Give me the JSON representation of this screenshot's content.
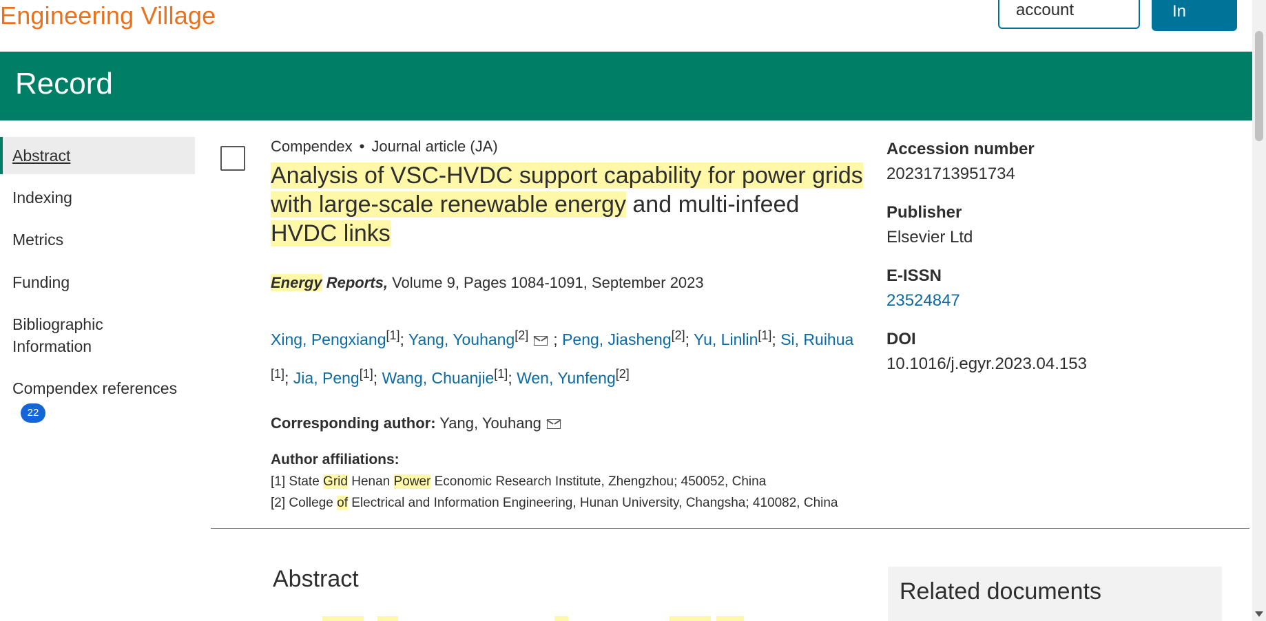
{
  "header": {
    "logo": "Engineering Village",
    "account_btn": "account",
    "signin_btn": "In"
  },
  "banner": {
    "title": "Record"
  },
  "sidebar": {
    "items": [
      {
        "label": "Abstract"
      },
      {
        "label": "Indexing"
      },
      {
        "label": "Metrics"
      },
      {
        "label": "Funding"
      },
      {
        "label": "Bibliographic"
      },
      {
        "label": "Information"
      },
      {
        "label": "Compendex references"
      }
    ],
    "badge": "22"
  },
  "record": {
    "database": "Compendex",
    "doc_type": "Journal article (JA)",
    "title_parts": [
      "Analysis of VSC-HVDC support capability for power grids with large-scale renewable energy",
      " and multi-infeed ",
      "HVDC links"
    ],
    "source_bold_1": "Energy",
    "source_bold_2": "Reports,",
    "source_rest": "Volume 9, Pages 1084-1091, September 2023",
    "authors": [
      {
        "name": "Xing, Pengxiang",
        "aff": "[1]"
      },
      {
        "name": "Yang, Youhang",
        "aff": "[2]"
      },
      {
        "name": "Peng, Jiasheng",
        "aff": "[2]"
      },
      {
        "name": "Yu, Linlin",
        "aff": "[1]"
      },
      {
        "name": "Si, Ruihua",
        "aff": "[1]"
      },
      {
        "name": "Jia, Peng",
        "aff": "[1]"
      },
      {
        "name": "Wang, Chuanjie",
        "aff": "[1]"
      },
      {
        "name": "Wen, Yunfeng",
        "aff": "[2]"
      }
    ],
    "sep": ";",
    "corr_label": "Corresponding author:",
    "corr_name": "Yang, Youhang",
    "aff_heading": "Author affiliations:",
    "affiliations": {
      "a1_prefix": "[1] State ",
      "a1_hl1": "Grid",
      "a1_mid": " Henan ",
      "a1_hl2": "Power",
      "a1_rest": " Economic Research Institute, Zhengzhou; 450052, China",
      "a2_prefix": "[2] College ",
      "a2_hl": "of",
      "a2_rest": " Electrical and Information Engineering, Hunan University, Changsha; 410082, China"
    }
  },
  "details": {
    "accession_label": "Accession number",
    "accession_value": "20231713951734",
    "publisher_label": "Publisher",
    "publisher_value": "Elsevier Ltd",
    "eissn_label": "E-ISSN",
    "eissn_value": "23524847",
    "doi_label": "DOI",
    "doi_value": "10.1016/j.egyr.2023.04.153"
  },
  "sections": {
    "abstract_heading": "Abstract",
    "related_heading": "Related documents"
  },
  "colors": {
    "banner": "#007e66",
    "logo": "#e9711c",
    "link": "#0b6aa2",
    "highlight": "#fff8a8",
    "badge": "#1565d8"
  }
}
